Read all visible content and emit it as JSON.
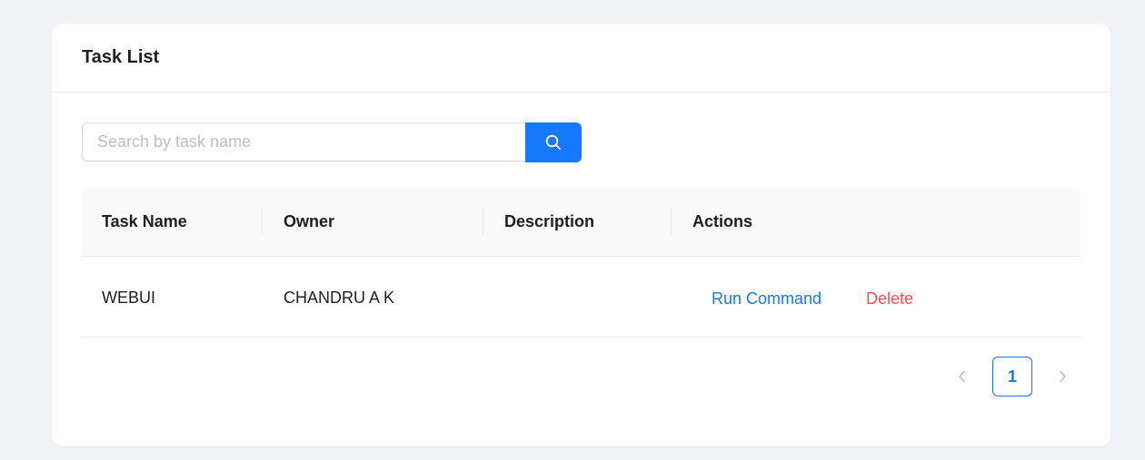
{
  "card": {
    "title": "Task List"
  },
  "search": {
    "placeholder": "Search by task name",
    "value": "",
    "button_icon": "search-icon"
  },
  "table": {
    "columns": [
      "Task Name",
      "Owner",
      "Description",
      "Actions"
    ],
    "rows": [
      {
        "task_name": "WEBUI",
        "owner": "CHANDRU A K",
        "description": "",
        "actions": {
          "run_label": "Run Command",
          "delete_label": "Delete"
        }
      }
    ]
  },
  "pagination": {
    "prev_icon": "chevron-left-icon",
    "current_page": "1",
    "next_icon": "chevron-right-icon"
  },
  "colors": {
    "background": "#f0f2f5",
    "primary": "#1677ff",
    "danger": "#ff4d4f",
    "header_bg": "#fafafa"
  }
}
